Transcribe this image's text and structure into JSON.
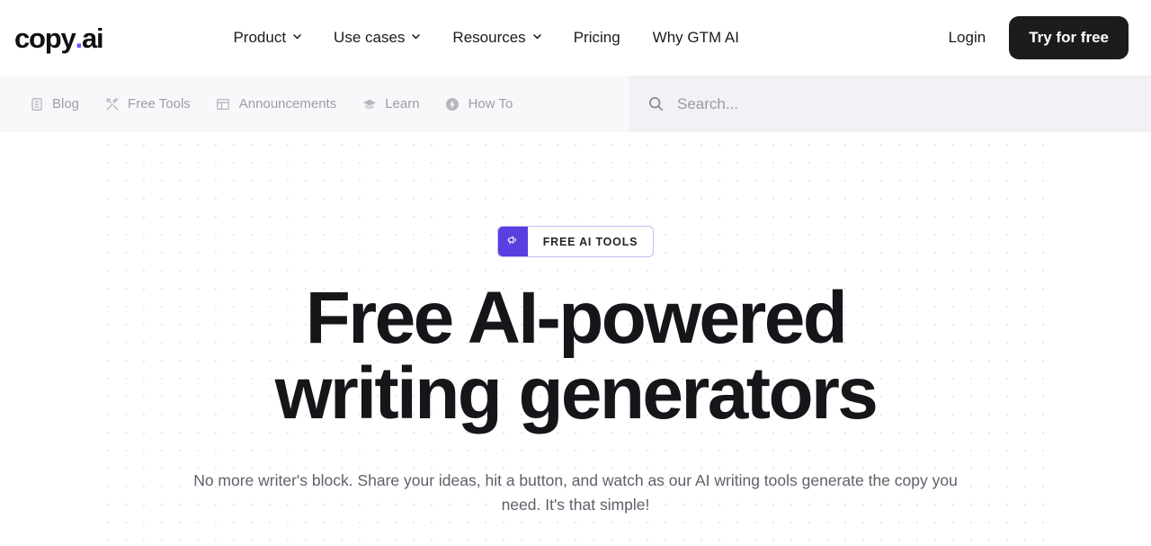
{
  "header": {
    "logo": {
      "text": "copy",
      "dot": ".",
      "suffix": "ai"
    },
    "nav": [
      {
        "label": "Product",
        "icon": "chevron-down-icon",
        "has_chevron": true
      },
      {
        "label": "Use cases",
        "icon": "chevron-down-icon",
        "has_chevron": true
      },
      {
        "label": "Resources",
        "icon": "chevron-down-icon",
        "has_chevron": true
      },
      {
        "label": "Pricing",
        "has_chevron": false
      },
      {
        "label": "Why GTM AI",
        "has_chevron": false
      }
    ],
    "login_label": "Login",
    "cta_label": "Try for free",
    "cta_bg": "#1c1c1f"
  },
  "subnav": {
    "items": [
      {
        "label": "Blog",
        "icon": "book-icon"
      },
      {
        "label": "Free Tools",
        "icon": "tools-icon"
      },
      {
        "label": "Announcements",
        "icon": "layout-icon"
      },
      {
        "label": "Learn",
        "icon": "graduation-cap-icon"
      },
      {
        "label": "How To",
        "icon": "lightning-circle-icon"
      }
    ],
    "search": {
      "icon": "search-icon",
      "placeholder": "Search...",
      "value": ""
    }
  },
  "hero": {
    "badge": {
      "icon": "megaphone-icon",
      "label": "FREE AI TOOLS",
      "accent": "#5b3ee0"
    },
    "title": "Free AI-powered writing generators",
    "subtitle": "No more writer's block. Share your ideas, hit a button, and watch as our AI writing tools generate the copy you need. It's that simple!"
  }
}
